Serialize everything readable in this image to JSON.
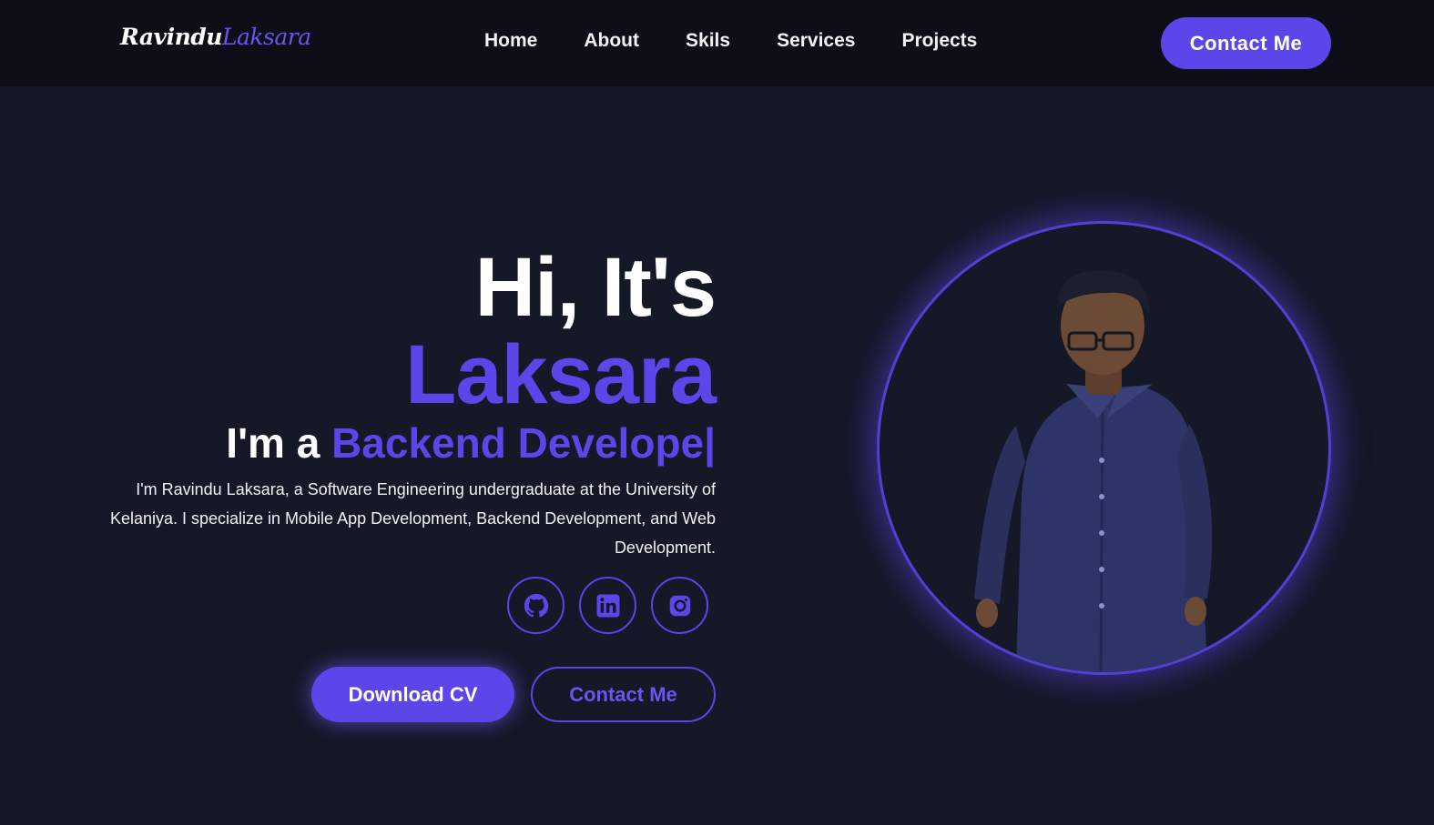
{
  "header": {
    "logo_first": "Ravindu",
    "logo_last": "Laksara",
    "nav": [
      "Home",
      "About",
      "Skils",
      "Services",
      "Projects"
    ],
    "contact_label": "Contact Me"
  },
  "hero": {
    "greeting": "Hi, It's",
    "name": "Laksara",
    "role_prefix": "I'm a",
    "role_value": "Backend Develope",
    "caret": "|",
    "intro": "I'm Ravindu Laksara, a Software Engineering undergraduate at the University of Kelaniya. I specialize in Mobile App Development, Backend Development, and Web Development.",
    "socials": [
      {
        "icon": "github-icon"
      },
      {
        "icon": "linkedin-icon"
      },
      {
        "icon": "instagram-icon"
      }
    ],
    "download_label": "Download CV",
    "contact_label": "Contact Me"
  },
  "theme": {
    "background": "#141827",
    "header_background": "#0c0f18",
    "accent": "#5b46ea",
    "text": "#ffffff"
  }
}
